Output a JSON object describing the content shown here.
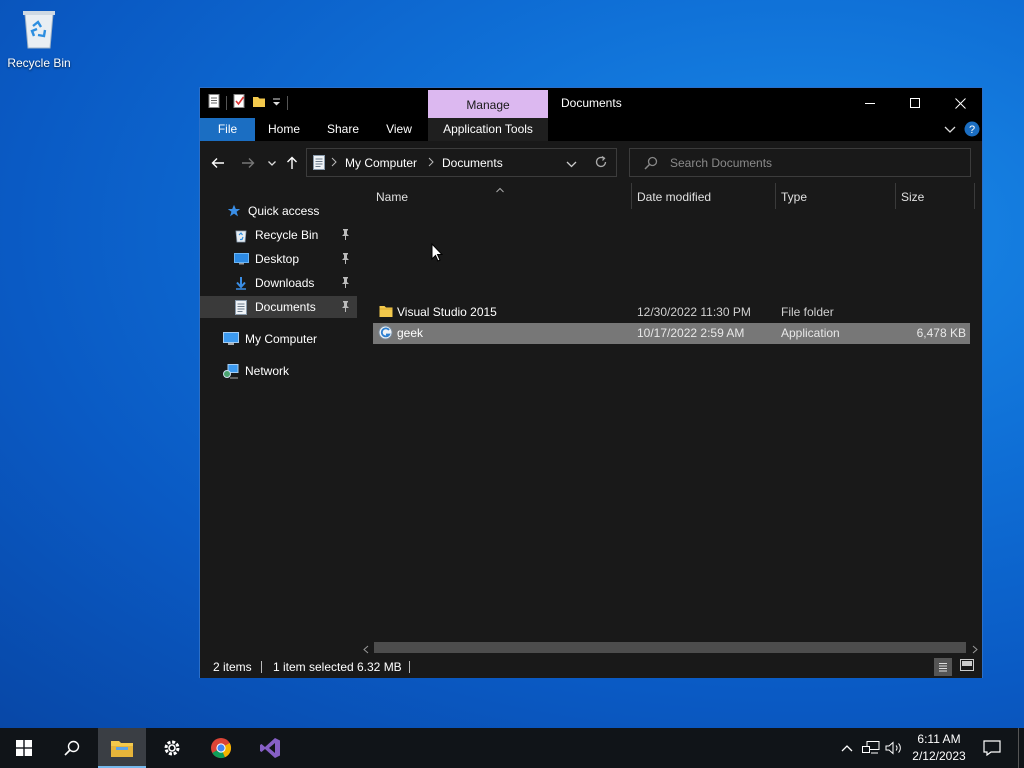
{
  "desktop": {
    "icons": [
      {
        "label": "Recycle Bin"
      }
    ]
  },
  "window": {
    "title": "Documents",
    "context_tab": "Manage",
    "ribbon_tabs": [
      "File",
      "Home",
      "Share",
      "View",
      "Application Tools"
    ],
    "breadcrumb": [
      "My Computer",
      "Documents"
    ],
    "search_placeholder": "Search Documents",
    "nav": {
      "quick_access": "Quick access",
      "pinned": [
        "Recycle Bin",
        "Desktop",
        "Downloads",
        "Documents"
      ],
      "my_computer": "My Computer",
      "network": "Network"
    },
    "columns": [
      "Name",
      "Date modified",
      "Type",
      "Size"
    ],
    "files": [
      {
        "name": "Visual Studio 2015",
        "date": "12/30/2022 11:30 PM",
        "type": "File folder",
        "size": ""
      },
      {
        "name": "geek",
        "date": "10/17/2022 2:59 AM",
        "type": "Application",
        "size": "6,478 KB"
      }
    ],
    "status": {
      "count": "2 items",
      "selected": "1 item selected",
      "size": "6.32 MB"
    }
  },
  "taskbar": {
    "time": "6:11 AM",
    "date": "2/12/2023"
  },
  "colors": {
    "accent": "#1b6ec2",
    "manage_tab": "#dcb8f0",
    "selection": "#777777"
  }
}
